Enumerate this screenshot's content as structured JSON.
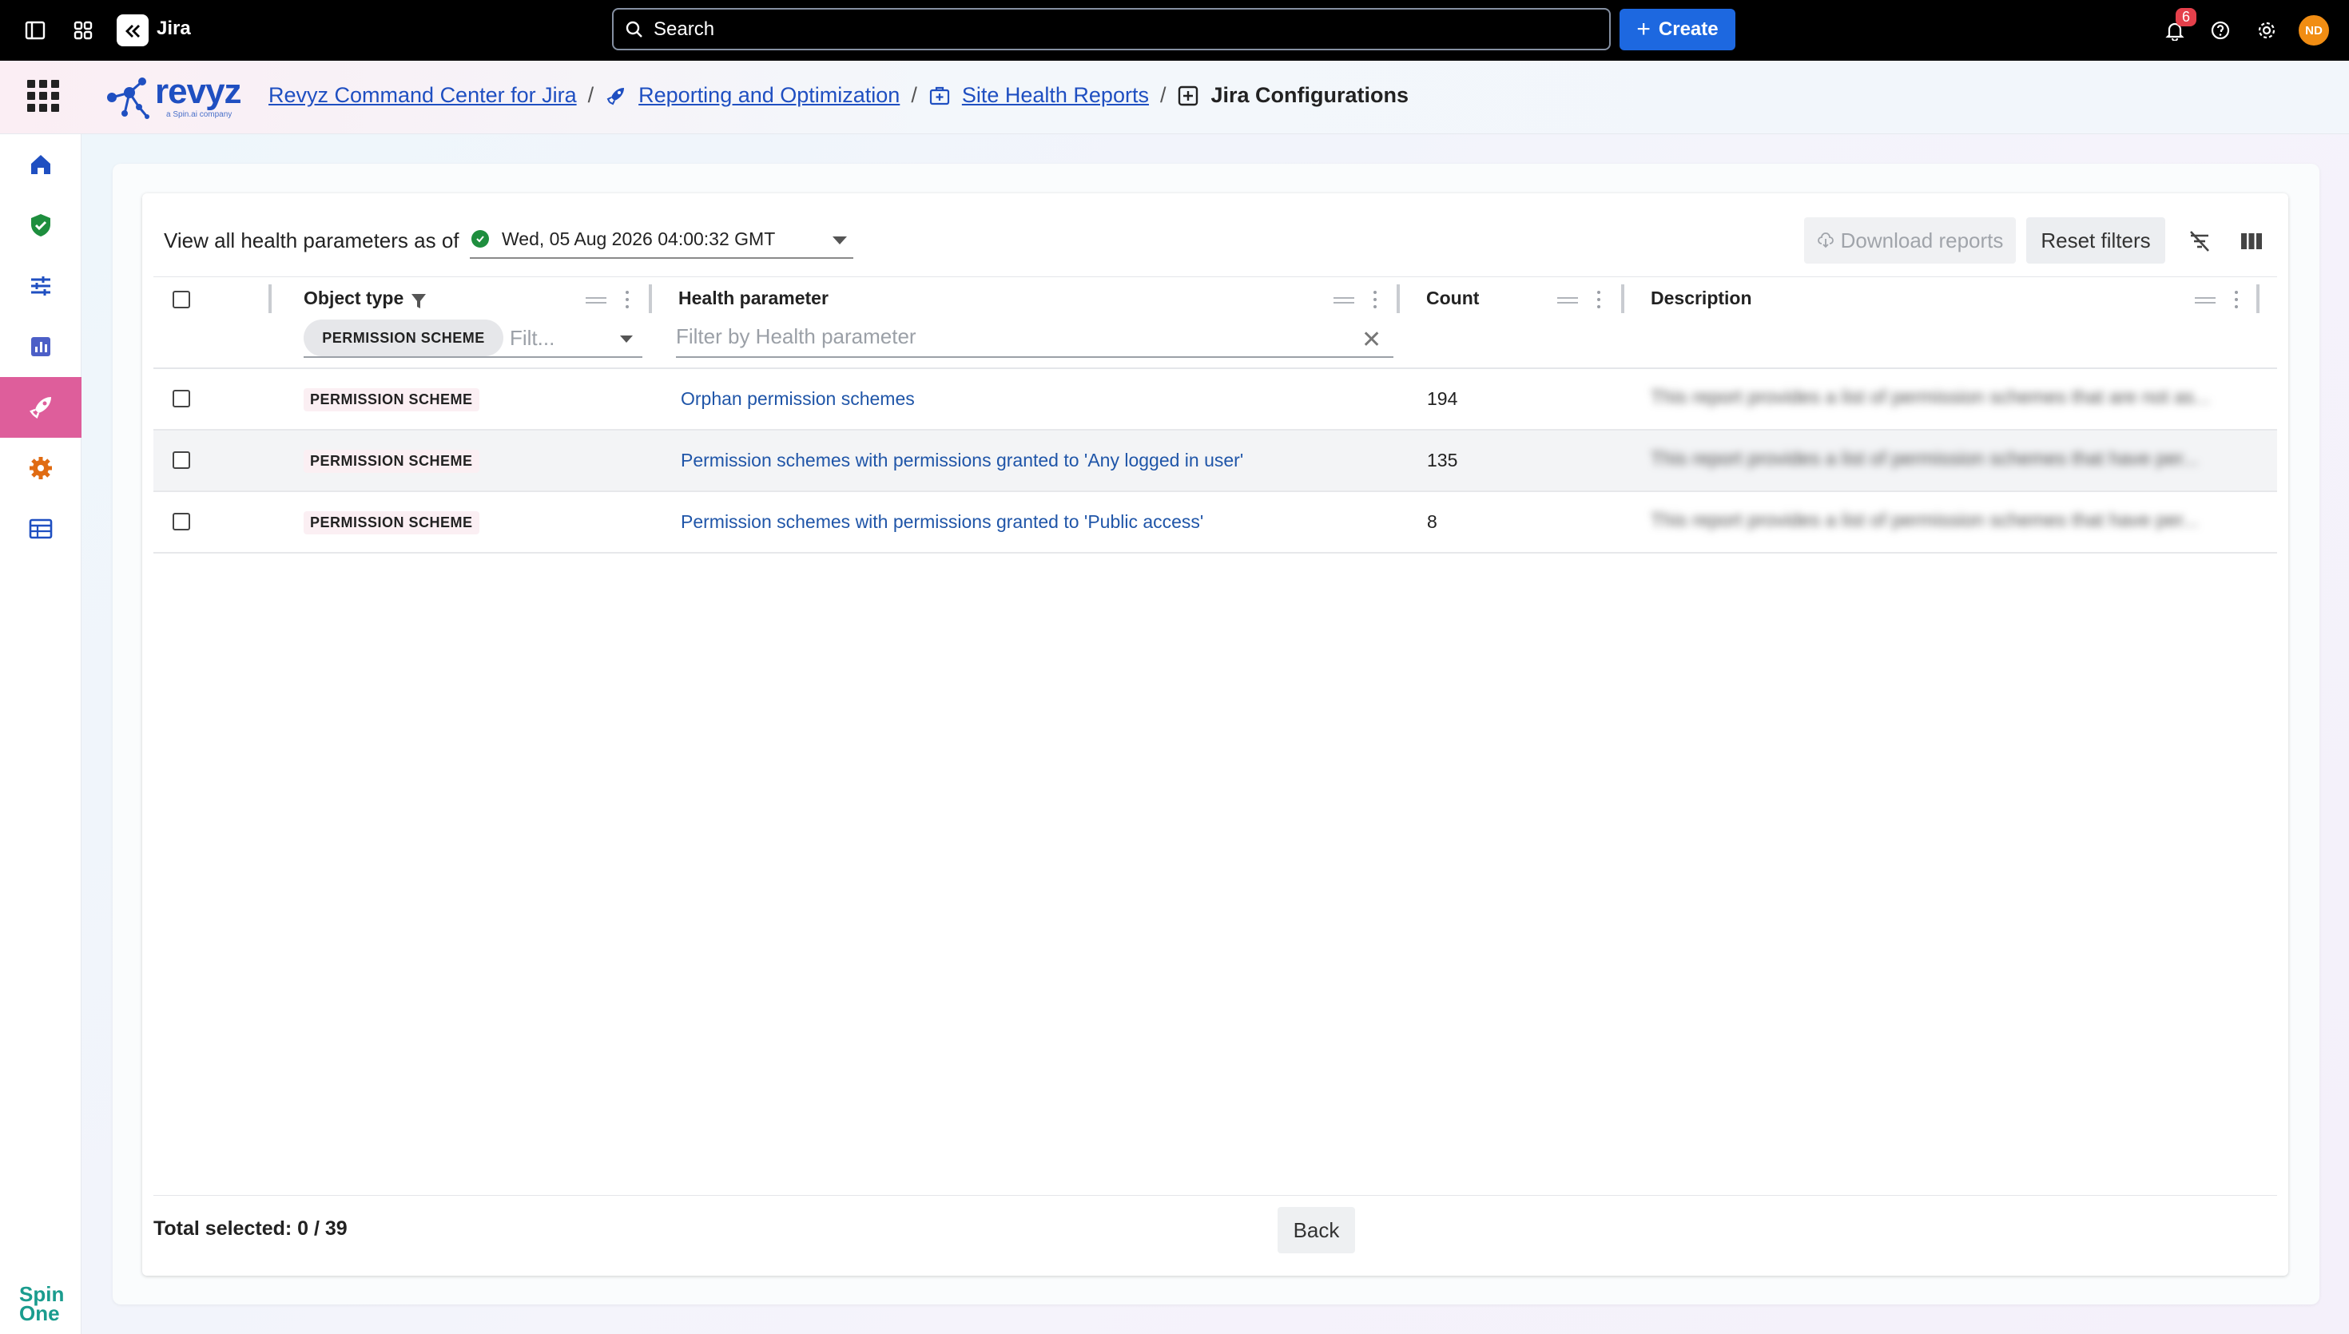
{
  "topbar": {
    "product": "Jira",
    "search_label": "Search",
    "create_label": "Create",
    "notification_count": "6",
    "avatar_initials": "ND"
  },
  "app": {
    "logo_word": "revyz",
    "logo_sub": "a Spin.ai company",
    "breadcrumbs": [
      {
        "label": "Revyz Command Center for Jira"
      },
      {
        "label": "Reporting and Optimization"
      },
      {
        "label": "Site Health Reports"
      },
      {
        "label": "Jira Configurations"
      }
    ]
  },
  "sidebar": {
    "items": [
      "home-icon",
      "shield-icon",
      "sliders-icon",
      "report-icon",
      "rocket-icon",
      "gear-icon",
      "table-icon"
    ],
    "active_index": 4,
    "brand": "Spin One"
  },
  "toolbar": {
    "label": "View all health parameters as of",
    "date_value": "Wed, 05 Aug 2026 04:00:32 GMT",
    "download_label": "Download reports",
    "reset_label": "Reset filters"
  },
  "table": {
    "columns": {
      "object_type": "Object type",
      "health_parameter": "Health parameter",
      "count": "Count",
      "description": "Description"
    },
    "filters": {
      "object_type_chip": "PERMISSION SCHEME",
      "object_type_placeholder": "Filt...",
      "health_parameter_placeholder": "Filter by Health parameter"
    },
    "rows": [
      {
        "object_type": "PERMISSION SCHEME",
        "health_parameter": "Orphan permission schemes",
        "count": "194",
        "description": "This report provides a list of permission schemes that are not as..."
      },
      {
        "object_type": "PERMISSION SCHEME",
        "health_parameter": "Permission schemes with permissions granted to 'Any logged in user'",
        "count": "135",
        "description": "This report provides a list of permission schemes that have per..."
      },
      {
        "object_type": "PERMISSION SCHEME",
        "health_parameter": "Permission schemes with permissions granted to 'Public access'",
        "count": "8",
        "description": "This report provides a list of permission schemes that have per..."
      }
    ]
  },
  "footer": {
    "total_selected": "Total selected: 0 / 39",
    "back_label": "Back"
  },
  "colors": {
    "accent": "#1d68e0",
    "active_nav": "#de5e9b",
    "link": "#1f55a8",
    "revyz_blue": "#1f4fc1"
  }
}
